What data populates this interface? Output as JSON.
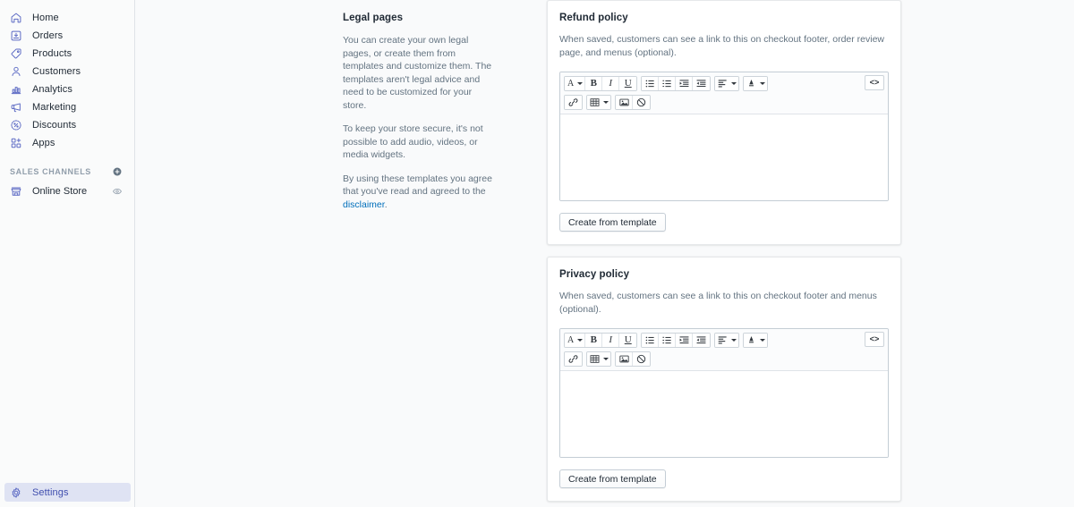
{
  "sidebar": {
    "nav_items": [
      {
        "label": "Home",
        "icon": "home-icon"
      },
      {
        "label": "Orders",
        "icon": "orders-icon"
      },
      {
        "label": "Products",
        "icon": "products-tag-icon"
      },
      {
        "label": "Customers",
        "icon": "customers-person-icon"
      },
      {
        "label": "Analytics",
        "icon": "analytics-bar-chart-icon"
      },
      {
        "label": "Marketing",
        "icon": "marketing-megaphone-icon"
      },
      {
        "label": "Discounts",
        "icon": "discounts-percent-icon"
      },
      {
        "label": "Apps",
        "icon": "apps-grid-icon"
      }
    ],
    "sales_channels": {
      "title": "SALES CHANNELS",
      "add_icon": "add-circle-icon",
      "items": [
        {
          "label": "Online Store",
          "icon": "online-store-icon",
          "action_icon": "eye-icon"
        }
      ]
    },
    "settings": {
      "label": "Settings",
      "icon": "gear-icon"
    }
  },
  "description": {
    "title": "Legal pages",
    "paragraphs": [
      "You can create your own legal pages, or create them from templates and customize them. The templates aren't legal advice and need to be customized for your store.",
      "To keep your store secure, it's not possible to add audio, videos, or media widgets.",
      "By using these templates you agree that you've read and agreed to the "
    ],
    "link_text": "disclaimer",
    "link_suffix": "."
  },
  "editor_toolbar": {
    "row1": {
      "group1": [
        {
          "name": "font-style-dropdown",
          "glyph": "A",
          "caret": true
        },
        {
          "name": "bold-button",
          "glyph": "B"
        },
        {
          "name": "italic-button",
          "glyph": "I"
        },
        {
          "name": "underline-button",
          "glyph": "U"
        }
      ],
      "group2": [
        {
          "name": "bulleted-list-button",
          "icon": "bullet-list-icon"
        },
        {
          "name": "numbered-list-button",
          "icon": "numbered-list-icon"
        },
        {
          "name": "indent-button",
          "icon": "indent-icon"
        },
        {
          "name": "outdent-button",
          "icon": "outdent-icon"
        }
      ],
      "group3": [
        {
          "name": "align-dropdown",
          "icon": "align-left-icon",
          "caret": true
        }
      ],
      "group4": [
        {
          "name": "text-color-dropdown",
          "icon": "color-fill-icon",
          "caret": true
        }
      ],
      "code_button": {
        "name": "html-code-view-button",
        "label": "<>"
      }
    },
    "row2": {
      "group1": [
        {
          "name": "insert-link-button",
          "icon": "link-chain-icon"
        }
      ],
      "group2": [
        {
          "name": "insert-table-dropdown",
          "icon": "table-icon",
          "caret": true
        }
      ],
      "group3": [
        {
          "name": "insert-image-button",
          "icon": "image-icon"
        },
        {
          "name": "clear-formatting-button",
          "icon": "no-entry-icon"
        }
      ]
    }
  },
  "cards": [
    {
      "id": "refund-policy",
      "title": "Refund policy",
      "description": "When saved, customers can see a link to this on checkout footer, order review page, and menus (optional).",
      "editor_value": "",
      "button_label": "Create from template"
    },
    {
      "id": "privacy-policy",
      "title": "Privacy policy",
      "description": "When saved, customers can see a link to this on checkout footer and menus (optional).",
      "editor_value": "",
      "button_label": "Create from template"
    }
  ],
  "colors": {
    "accent": "#5c6ac4",
    "link": "#006fbb",
    "page_bg": "#f9fafb",
    "card_bg": "#ffffff",
    "text_primary": "#212b36",
    "text_secondary": "#637381",
    "selected_bg": "#dfe3f3"
  }
}
